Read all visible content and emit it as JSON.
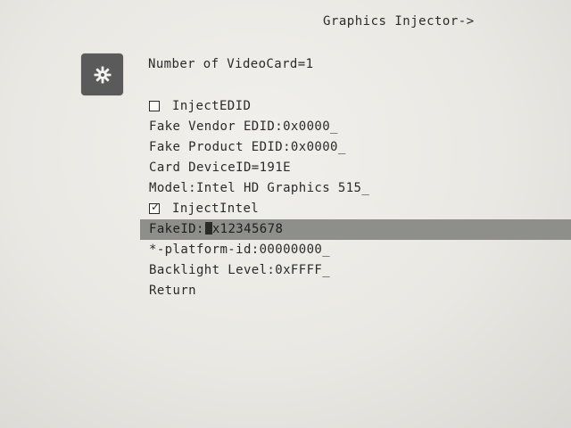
{
  "header": {
    "title": "Graphics Injector->"
  },
  "icon": {
    "name": "gear-icon",
    "tile_color": "#5a5a5a"
  },
  "info": {
    "video_card_count": "Number of VideoCard=1"
  },
  "menu": {
    "items": [
      {
        "id": "inject-edid",
        "label": "InjectEDID",
        "type": "checkbox",
        "checked": false
      },
      {
        "id": "fake-vendor-edid",
        "label": "Fake Vendor EDID:0x0000_",
        "type": "input"
      },
      {
        "id": "fake-product-edid",
        "label": "Fake Product EDID:0x0000_",
        "type": "input"
      },
      {
        "id": "card-device-id",
        "label": "Card DeviceID=191E",
        "type": "text"
      },
      {
        "id": "model",
        "label": "Model:Intel HD Graphics 515_",
        "type": "input"
      },
      {
        "id": "inject-intel",
        "label": "InjectIntel",
        "type": "checkbox",
        "checked": true
      },
      {
        "id": "fake-id",
        "label_prefix": "FakeID:",
        "label_value": "x12345678",
        "type": "input",
        "selected": true
      },
      {
        "id": "platform-id",
        "label": "*-platform-id:00000000_",
        "type": "input"
      },
      {
        "id": "backlight-level",
        "label": "Backlight Level:0xFFFF_",
        "type": "input"
      },
      {
        "id": "return",
        "label": "Return",
        "type": "action"
      }
    ],
    "checked_mark": "✓",
    "selection_color": "#8e8e8b"
  }
}
